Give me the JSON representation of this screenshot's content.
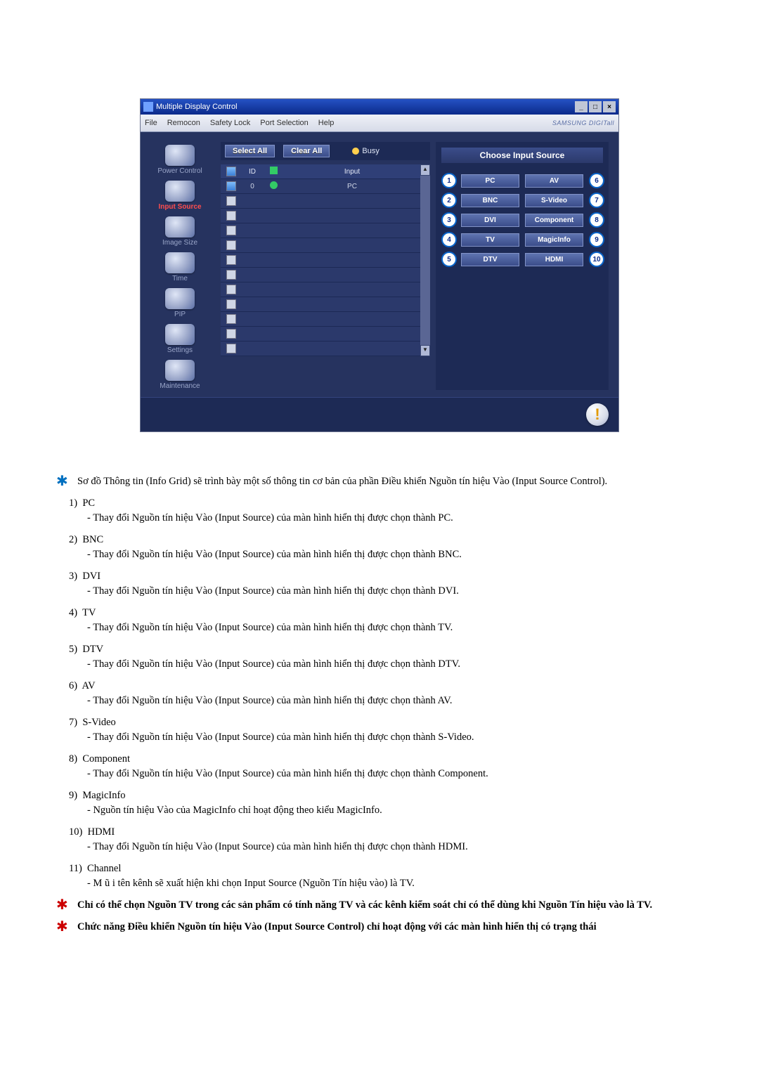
{
  "window": {
    "title": "Multiple Display Control",
    "min": "_",
    "max": "□",
    "close": "×"
  },
  "menubar": {
    "file": "File",
    "remocon": "Remocon",
    "safety": "Safety Lock",
    "port": "Port Selection",
    "help": "Help",
    "brand": "SAMSUNG DIGITall"
  },
  "sidebar": {
    "items": [
      "Power Control",
      "Input Source",
      "Image Size",
      "Time",
      "PIP",
      "Settings",
      "Maintenance"
    ]
  },
  "toolbar": {
    "select_all": "Select All",
    "clear_all": "Clear All",
    "busy": "Busy"
  },
  "grid": {
    "head_id": "ID",
    "head_input": "Input",
    "rows": [
      {
        "id": "0",
        "input": "PC",
        "checked": true
      }
    ],
    "blank_rows": 11
  },
  "panel": {
    "title": "Choose Input Source",
    "left": [
      "PC",
      "BNC",
      "DVI",
      "TV",
      "DTV"
    ],
    "right": [
      "AV",
      "S-Video",
      "Component",
      "MagicInfo",
      "HDMI"
    ],
    "nums_left": [
      "1",
      "2",
      "3",
      "4",
      "5"
    ],
    "nums_right": [
      "6",
      "7",
      "8",
      "9",
      "10"
    ]
  },
  "doc": {
    "intro": "Sơ đồ Thông tin (Info Grid) sẽ trình bày một số thông tin cơ bản của phần Điều khiển Nguồn tín hiệu Vào (Input Source Control).",
    "items": [
      {
        "n": "1)",
        "t": "PC",
        "s": "- Thay đổi Nguồn tín hiệu Vào (Input Source) của màn hình hiển thị được chọn thành PC."
      },
      {
        "n": "2)",
        "t": "BNC",
        "s": "- Thay đổi Nguồn tín hiệu Vào (Input Source) của màn hình hiển thị được chọn thành BNC."
      },
      {
        "n": "3)",
        "t": "DVI",
        "s": "- Thay đổi Nguồn tín hiệu Vào (Input Source) của màn hình hiển thị được chọn thành DVI."
      },
      {
        "n": "4)",
        "t": "TV",
        "s": "- Thay đổi Nguồn tín hiệu Vào (Input Source) của màn hình hiển thị được chọn thành TV."
      },
      {
        "n": "5)",
        "t": "DTV",
        "s": "- Thay đổi Nguồn tín hiệu Vào (Input Source) của màn hình hiển thị được chọn thành DTV."
      },
      {
        "n": "6)",
        "t": "AV",
        "s": "- Thay đổi Nguồn tín hiệu Vào (Input Source) của màn hình hiển thị được chọn thành AV."
      },
      {
        "n": "7)",
        "t": "S-Video",
        "s": "- Thay đổi Nguồn tín hiệu Vào (Input Source) của màn hình hiển thị được chọn thành S-Video."
      },
      {
        "n": "8)",
        "t": "Component",
        "s": "- Thay đổi Nguồn tín hiệu Vào (Input Source) của màn hình hiển thị được chọn thành Component."
      },
      {
        "n": "9)",
        "t": "MagicInfo",
        "s": "- Nguồn tín hiệu Vào của MagicInfo chỉ hoạt động theo kiểu MagicInfo."
      },
      {
        "n": "10)",
        "t": "HDMI",
        "s": "- Thay đổi Nguồn tín hiệu Vào (Input Source) của màn hình hiển thị được chọn thành HDMI."
      },
      {
        "n": "11)",
        "t": "Channel",
        "s": "- M ũ i tên kênh sẽ xuất hiện khi chọn Input Source (Nguồn Tín hiệu vào) là TV."
      }
    ],
    "note1": "Chỉ có thể chọn Nguồn TV trong các sản phẩm có tính năng TV và các kênh kiểm soát chỉ có thể dùng khi Nguồn Tín hiệu vào là TV.",
    "note2": "Chức năng Điều khiển Nguồn tín hiệu Vào (Input Source Control) chỉ hoạt động với các màn hình hiển thị có trạng thái"
  }
}
